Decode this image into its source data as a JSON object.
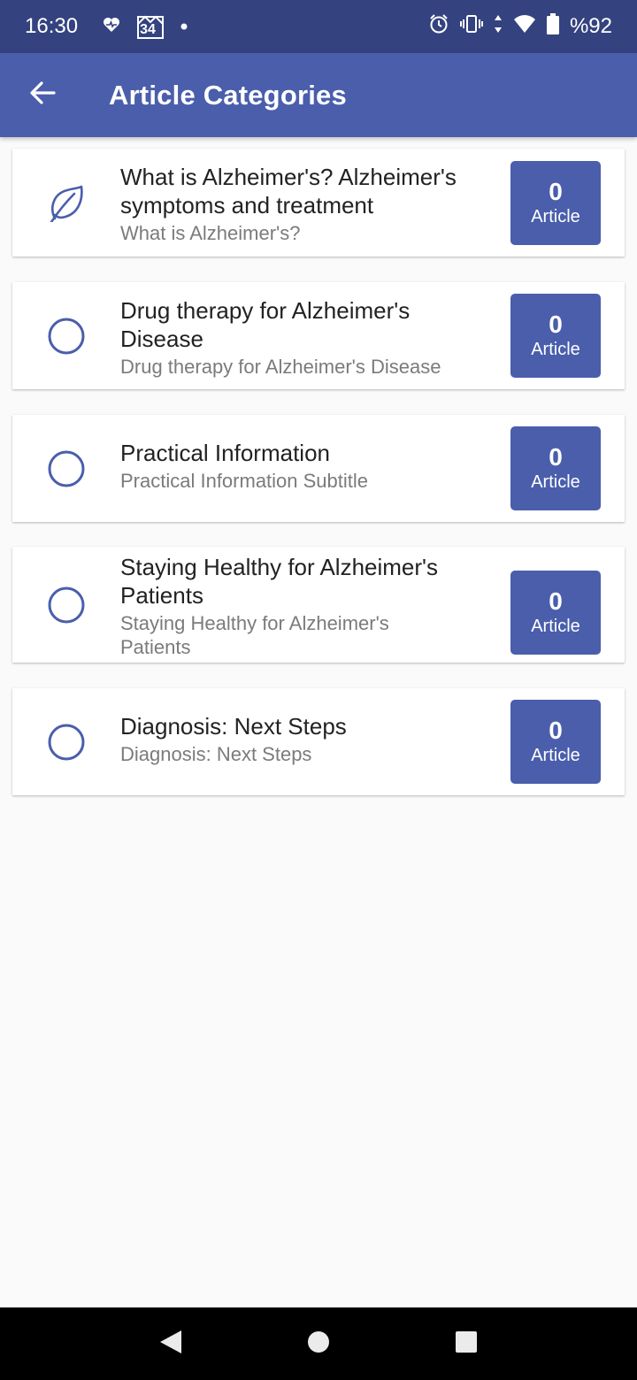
{
  "status_bar": {
    "time": "16:30",
    "left_icons": [
      "heart-icon",
      "calendar-34-icon",
      "dot-icon"
    ],
    "calendar_day": "34",
    "battery": "%92",
    "right_icons": [
      "alarm-icon",
      "vibrate-icon",
      "data-arrows-icon",
      "wifi-icon",
      "battery-icon"
    ]
  },
  "app_bar": {
    "title": "Article Categories",
    "back_icon": "arrow-left-icon"
  },
  "categories": [
    {
      "title": "What is Alzheimer's? Alzheimer's symptoms and treatment",
      "subtitle": "What is Alzheimer's?",
      "icon": "leaf-icon",
      "count": "0",
      "count_label": "Article"
    },
    {
      "title": "Drug therapy for Alzheimer's Disease",
      "subtitle": "Drug therapy for Alzheimer's Disease",
      "icon": "circle-icon",
      "count": "0",
      "count_label": "Article"
    },
    {
      "title": "Practical Information",
      "subtitle": "Practical Information Subtitle",
      "icon": "circle-icon",
      "count": "0",
      "count_label": "Article"
    },
    {
      "title": "Staying Healthy for Alzheimer's Patients",
      "subtitle": "Staying Healthy for Alzheimer's Patients",
      "icon": "circle-icon",
      "count": "0",
      "count_label": "Article"
    },
    {
      "title": "Diagnosis: Next Steps",
      "subtitle": "Diagnosis: Next Steps",
      "icon": "circle-icon",
      "count": "0",
      "count_label": "Article"
    }
  ],
  "nav_bar": {
    "icons": [
      "back-triangle-icon",
      "home-circle-icon",
      "recents-square-icon"
    ]
  },
  "colors": {
    "status_bar": "#34437f",
    "primary": "#4a5eac",
    "background": "#fafafa"
  }
}
